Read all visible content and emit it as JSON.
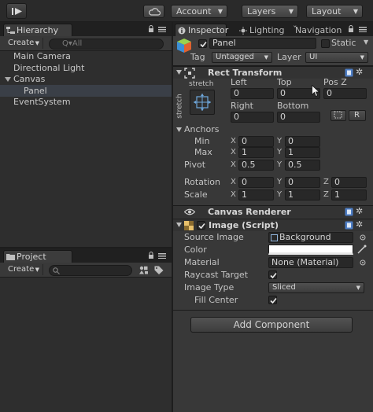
{
  "toolbar": {
    "account_label": "Account",
    "layers_label": "Layers",
    "layout_label": "Layout"
  },
  "hierarchy": {
    "tab_label": "Hierarchy",
    "create_label": "Create",
    "search_placeholder": "Q▾All",
    "items": [
      {
        "label": "Main Camera",
        "indent": 0,
        "selected": false
      },
      {
        "label": "Directional Light",
        "indent": 0,
        "selected": false
      },
      {
        "label": "Canvas",
        "indent": 0,
        "expanded": true,
        "selected": false
      },
      {
        "label": "Panel",
        "indent": 1,
        "selected": true
      },
      {
        "label": "EventSystem",
        "indent": 0,
        "selected": false
      }
    ]
  },
  "project": {
    "tab_label": "Project",
    "create_label": "Create"
  },
  "inspector": {
    "tabs": [
      {
        "label": "Inspector",
        "active": true
      },
      {
        "label": "Lighting",
        "active": false
      },
      {
        "label": "Navigation",
        "active": false
      }
    ],
    "object": {
      "name": "Panel",
      "active": true,
      "static_label": "Static",
      "static": false,
      "tag_label": "Tag",
      "tag_value": "Untagged",
      "layer_label": "Layer",
      "layer_value": "UI"
    },
    "rect_transform": {
      "title": "Rect Transform",
      "anchor_preset_h": "stretch",
      "anchor_preset_v": "stretch",
      "headers": {
        "left": "Left",
        "top": "Top",
        "posz": "Pos Z",
        "right": "Right",
        "bottom": "Bottom"
      },
      "left": "0",
      "top": "0",
      "posz": "0",
      "right": "0",
      "bottom": "0",
      "r_button": "R",
      "anchors_label": "Anchors",
      "min_label": "Min",
      "min_x": "0",
      "min_y": "0",
      "max_label": "Max",
      "max_x": "1",
      "max_y": "1",
      "pivot_label": "Pivot",
      "pivot_x": "0.5",
      "pivot_y": "0.5",
      "rotation_label": "Rotation",
      "rot_x": "0",
      "rot_y": "0",
      "rot_z": "0",
      "scale_label": "Scale",
      "scale_x": "1",
      "scale_y": "1",
      "scale_z": "1",
      "axis_x": "X",
      "axis_y": "Y",
      "axis_z": "Z"
    },
    "canvas_renderer": {
      "title": "Canvas Renderer"
    },
    "image_script": {
      "title": "Image (Script)",
      "enabled": true,
      "source_image_label": "Source Image",
      "source_image_value": "Background",
      "color_label": "Color",
      "color_value": "#ffffff",
      "material_label": "Material",
      "material_value": "None (Material)",
      "raycast_label": "Raycast Target",
      "raycast": true,
      "image_type_label": "Image Type",
      "image_type_value": "Sliced",
      "fill_center_label": "Fill Center",
      "fill_center": true
    },
    "add_component_label": "Add Component"
  }
}
